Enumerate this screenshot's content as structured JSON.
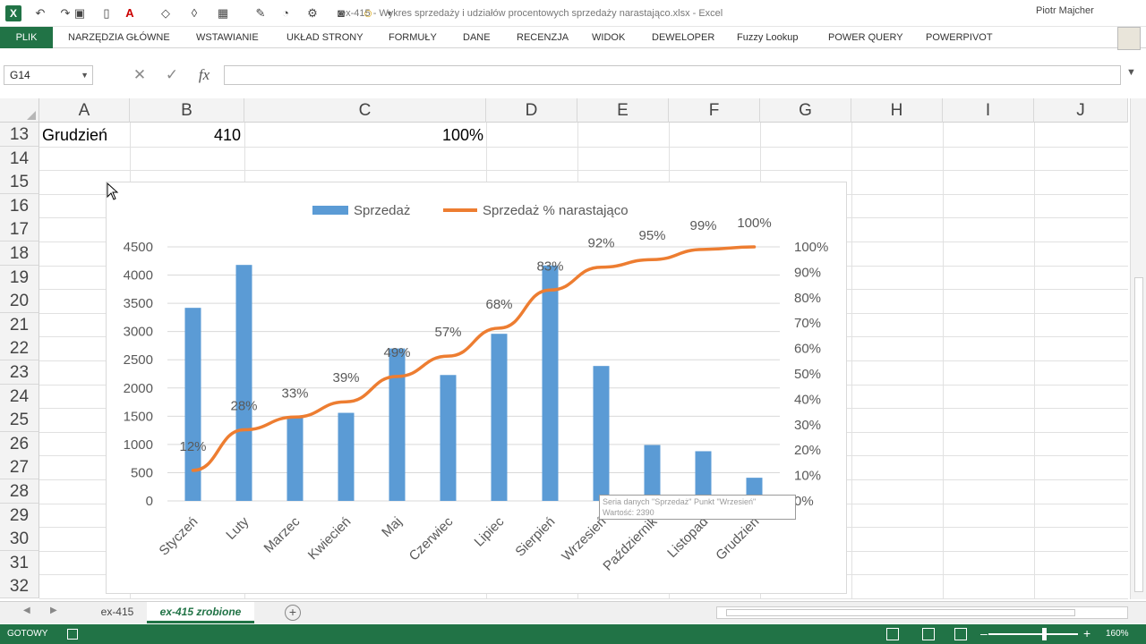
{
  "window": {
    "title": "ex-415 - Wykres sprzedaży i udziałów procentowych sprzedaży narastająco.xlsx - Excel",
    "user": "Piotr Majcher"
  },
  "ribbon": {
    "tabs": [
      "PLIK",
      "NARZĘDZIA GŁÓWNE",
      "WSTAWIANIE",
      "UKŁAD STRONY",
      "FORMUŁY",
      "DANE",
      "RECENZJA",
      "WIDOK",
      "DEWELOPER",
      "Fuzzy Lookup",
      "POWER QUERY",
      "POWERPIVOT"
    ]
  },
  "formula_bar": {
    "name_box": "G14",
    "fx": "fx",
    "cancel": "✕",
    "enter": "✓",
    "value": ""
  },
  "grid": {
    "columns": [
      "A",
      "B",
      "C",
      "D",
      "E",
      "F",
      "G",
      "H",
      "I",
      "J"
    ],
    "rows": [
      "13",
      "14",
      "15",
      "16",
      "17",
      "18",
      "19",
      "20",
      "21",
      "22",
      "23",
      "24",
      "25",
      "26",
      "27",
      "28",
      "29",
      "30",
      "31",
      "32"
    ],
    "row13": {
      "a": "Grudzień",
      "b": "410",
      "c": "100%"
    }
  },
  "chart_data": {
    "type": "bar",
    "categories": [
      "Styczeń",
      "Luty",
      "Marzec",
      "Kwiecień",
      "Maj",
      "Czerwiec",
      "Lipiec",
      "Sierpień",
      "Wrzesień",
      "Październik",
      "Listopad",
      "Grudzień"
    ],
    "series": [
      {
        "name": "Sprzedaż",
        "type": "bar",
        "axis": "left",
        "color": "#5b9bd5",
        "values": [
          3420,
          4180,
          1500,
          1560,
          2700,
          2230,
          2960,
          4170,
          2390,
          990,
          880,
          410
        ]
      },
      {
        "name": "Sprzedaż % narastająco",
        "type": "line",
        "axis": "right",
        "color": "#ed7d31",
        "values": [
          12,
          28,
          33,
          39,
          49,
          57,
          68,
          83,
          92,
          95,
          99,
          100
        ],
        "labels": [
          "12%",
          "28%",
          "33%",
          "39%",
          "49%",
          "57%",
          "68%",
          "83%",
          "92%",
          "95%",
          "99%",
          "100%"
        ]
      }
    ],
    "y_left": {
      "ylim": [
        0,
        4500
      ],
      "ticks": [
        "0",
        "500",
        "1000",
        "1500",
        "2000",
        "2500",
        "3000",
        "3500",
        "4000",
        "4500"
      ]
    },
    "y_right": {
      "ylim": [
        0,
        100
      ],
      "ticks": [
        "0%",
        "10%",
        "20%",
        "30%",
        "40%",
        "50%",
        "60%",
        "70%",
        "80%",
        "90%",
        "100%"
      ]
    },
    "grid": true,
    "legend_position": "top"
  },
  "tooltip": {
    "line1": "Seria danych \"Sprzedaż\" Punkt \"Wrzesień\"",
    "line2": "Wartość: 2390"
  },
  "sheets": {
    "tabs": [
      "ex-415",
      "ex-415 zrobione"
    ],
    "active": "ex-415 zrobione",
    "add": "+"
  },
  "status": {
    "text": "GOTOWY",
    "zoom": "160%",
    "zoom_fraction": 0.6
  },
  "colors": {
    "excel_green": "#217346",
    "bar": "#5b9bd5",
    "line": "#ed7d31"
  }
}
